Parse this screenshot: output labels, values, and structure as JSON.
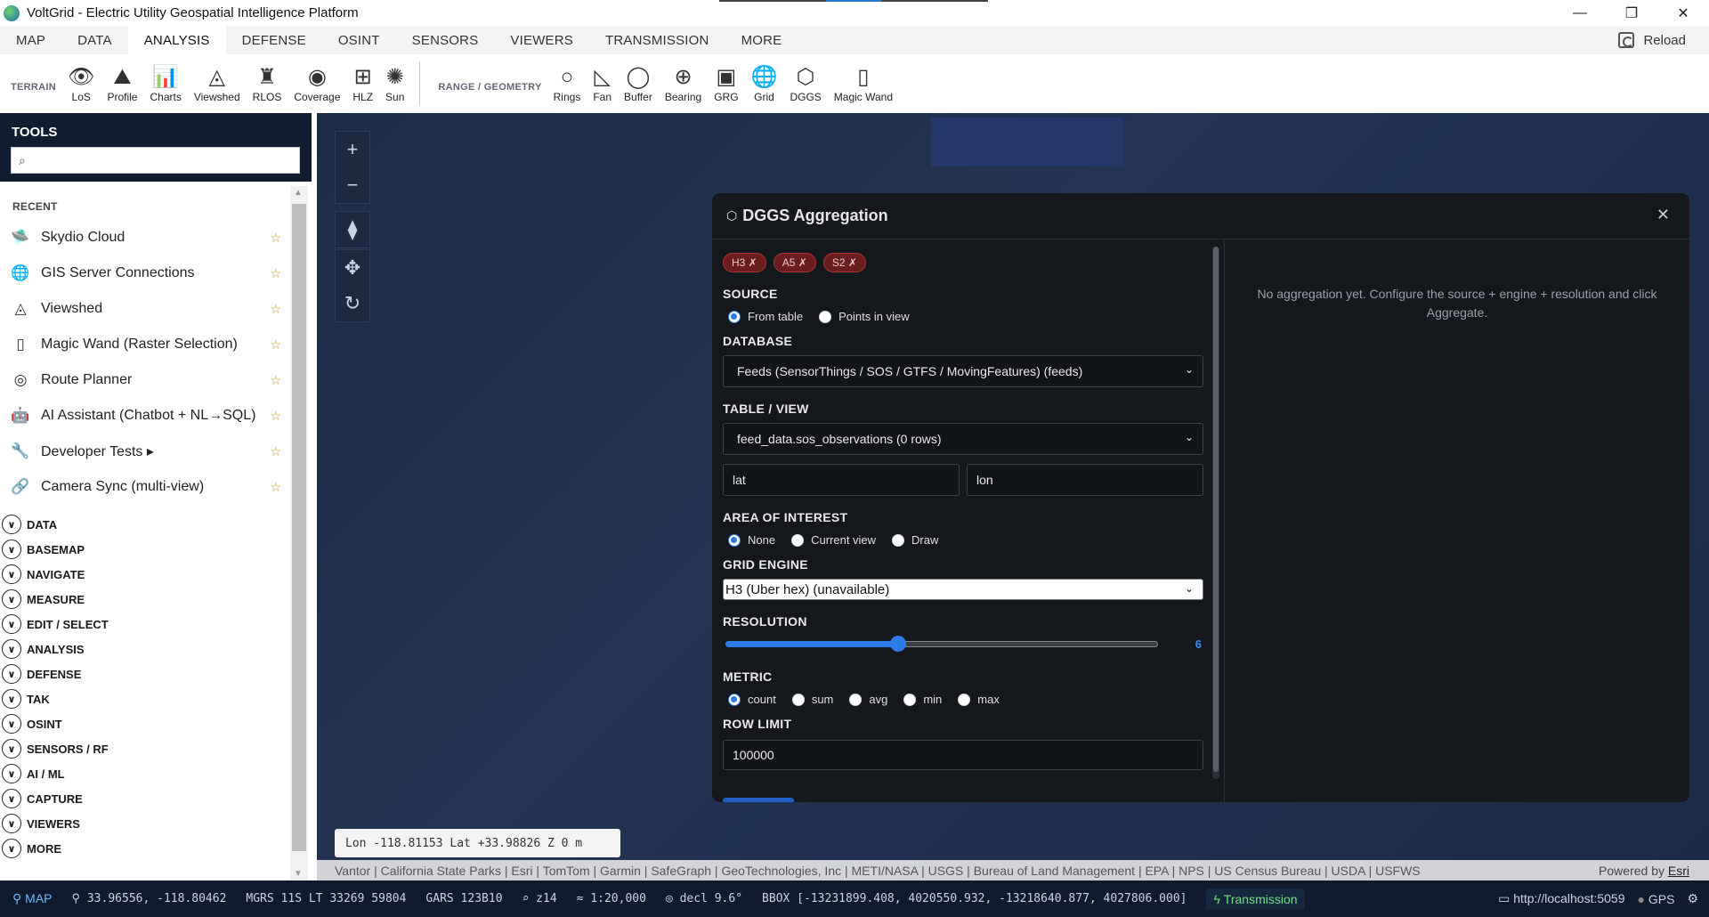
{
  "window": {
    "title": "VoltGrid - Electric Utility Geospatial Intelligence Platform",
    "controls": [
      "—",
      "❐",
      "✕"
    ]
  },
  "menu": {
    "tabs": [
      {
        "label": "MAP",
        "active": false
      },
      {
        "label": "DATA",
        "active": false
      },
      {
        "label": "ANALYSIS",
        "active": true
      },
      {
        "label": "DEFENSE",
        "active": false
      },
      {
        "label": "OSINT",
        "active": false
      },
      {
        "label": "SENSORS",
        "active": false
      },
      {
        "label": "VIEWERS",
        "active": false
      },
      {
        "label": "TRANSMISSION",
        "active": false
      },
      {
        "label": "MORE",
        "active": false
      }
    ],
    "reload_label": "Reload"
  },
  "ribbon": {
    "terrain_label": "TERRAIN",
    "terrain_tools": [
      {
        "label": "LoS",
        "icon": "eye-icon",
        "glyph": "👁"
      },
      {
        "label": "Profile",
        "icon": "profile-icon",
        "glyph": "⛰"
      },
      {
        "label": "Charts",
        "icon": "chart-icon",
        "glyph": "📊"
      },
      {
        "label": "Viewshed",
        "icon": "viewshed-icon",
        "glyph": "◬"
      },
      {
        "label": "RLOS",
        "icon": "tower-icon",
        "glyph": "♜"
      },
      {
        "label": "Coverage",
        "icon": "coverage-icon",
        "glyph": "◉"
      },
      {
        "label": "HLZ",
        "icon": "helicopter-icon",
        "glyph": "⊞"
      },
      {
        "label": "Sun",
        "icon": "sun-icon",
        "glyph": "✺"
      }
    ],
    "range_label": "RANGE / GEOMETRY",
    "range_tools": [
      {
        "label": "Rings",
        "icon": "rings-icon",
        "glyph": "○"
      },
      {
        "label": "Fan",
        "icon": "fan-icon",
        "glyph": "◺"
      },
      {
        "label": "Buffer",
        "icon": "buffer-icon",
        "glyph": "◯"
      },
      {
        "label": "Bearing",
        "icon": "compass-icon",
        "glyph": "⊕"
      },
      {
        "label": "GRG",
        "icon": "grg-icon",
        "glyph": "▣"
      },
      {
        "label": "Grid",
        "icon": "globe-grid-icon",
        "glyph": "🌐"
      },
      {
        "label": "DGGS",
        "icon": "hexagon-icon",
        "glyph": "⬡"
      },
      {
        "label": "Magic Wand",
        "icon": "magic-wand-icon",
        "glyph": "▯"
      }
    ]
  },
  "tools": {
    "title": "TOOLS",
    "search_placeholder": "",
    "recent_label": "RECENT",
    "recent": [
      {
        "label": "Skydio Cloud",
        "icon": "drone-icon",
        "glyph": "🛸"
      },
      {
        "label": "GIS Server Connections",
        "icon": "globe-icon",
        "glyph": "🌐"
      },
      {
        "label": "Viewshed",
        "icon": "viewshed-icon",
        "glyph": "◬"
      },
      {
        "label": "Magic Wand (Raster Selection)",
        "icon": "magic-wand-icon",
        "glyph": "▯"
      },
      {
        "label": "Route Planner",
        "icon": "route-icon",
        "glyph": "◎"
      },
      {
        "label": "AI Assistant (Chatbot + NL→SQL)",
        "icon": "robot-icon",
        "glyph": "🤖"
      },
      {
        "label": "Developer Tests ▸",
        "icon": "wrench-icon",
        "glyph": "🔧"
      },
      {
        "label": "Camera Sync (multi-view)",
        "icon": "camera-sync-icon",
        "glyph": "🔗"
      }
    ],
    "categories": [
      "DATA",
      "BASEMAP",
      "NAVIGATE",
      "MEASURE",
      "EDIT / SELECT",
      "ANALYSIS",
      "DEFENSE",
      "TAK",
      "OSINT",
      "SENSORS / RF",
      "AI / ML",
      "CAPTURE",
      "VIEWERS",
      "MORE"
    ]
  },
  "map": {
    "coord_readout": "Lon -118.81153   Lat +33.98826   Z 0 m",
    "attribution": "Vantor | California State Parks | Esri | TomTom | Garmin | SafeGraph | GeoTechnologies, Inc | METI/NASA | USGS | Bureau of Land Management | EPA | NPS | US Census Bureau | USDA | USFWS",
    "powered_by": "Powered by",
    "powered_by_link": "Esri"
  },
  "dialog": {
    "title": "DGGS Aggregation",
    "chips": [
      "H3 ✗",
      "A5 ✗",
      "S2 ✗"
    ],
    "source_label": "SOURCE",
    "source_options": [
      {
        "label": "From table",
        "selected": true
      },
      {
        "label": "Points in view",
        "selected": false
      }
    ],
    "database_label": "DATABASE",
    "database_value": "Feeds (SensorThings / SOS / GTFS / MovingFeatures) (feeds)",
    "table_label": "TABLE / VIEW",
    "table_value": "feed_data.sos_observations (0 rows)",
    "lat_field": "lat",
    "lon_field": "lon",
    "aoi_label": "AREA OF INTEREST",
    "aoi_options": [
      {
        "label": "None",
        "selected": true
      },
      {
        "label": "Current view",
        "selected": false
      },
      {
        "label": "Draw",
        "selected": false
      }
    ],
    "engine_label": "GRID ENGINE",
    "engine_value": "H3 (Uber hex) (unavailable)",
    "resolution_label": "RESOLUTION",
    "resolution_value": "6",
    "resolution_fraction": 0.4,
    "metric_label": "METRIC",
    "metric_options": [
      {
        "label": "count",
        "selected": true
      },
      {
        "label": "sum",
        "selected": false
      },
      {
        "label": "avg",
        "selected": false
      },
      {
        "label": "min",
        "selected": false
      },
      {
        "label": "max",
        "selected": false
      }
    ],
    "row_limit_label": "ROW LIMIT",
    "row_limit_value": "100000",
    "empty_message": "No aggregation yet. Configure the source + engine + resolution and click Aggregate."
  },
  "status": {
    "mode": "MAP",
    "position": "33.96556, -118.80462",
    "mgrs": "MGRS 11S LT 33269 59804",
    "gars": "GARS 123B10",
    "zoom": "z14",
    "scale": "≈ 1:20,000",
    "declination": "decl 9.6°",
    "bbox": "BBOX [-13231899.408, 4020550.932, -13218640.877, 4027806.000]",
    "transmission": "Transmission",
    "server": "http://localhost:5059",
    "gps": "GPS"
  },
  "colors": {
    "accent": "#2d7be6",
    "panel_dark": "#101c30",
    "dialog_bg": "#14171c",
    "chip_red": "#6b1d1d",
    "star": "#c99a1a"
  }
}
